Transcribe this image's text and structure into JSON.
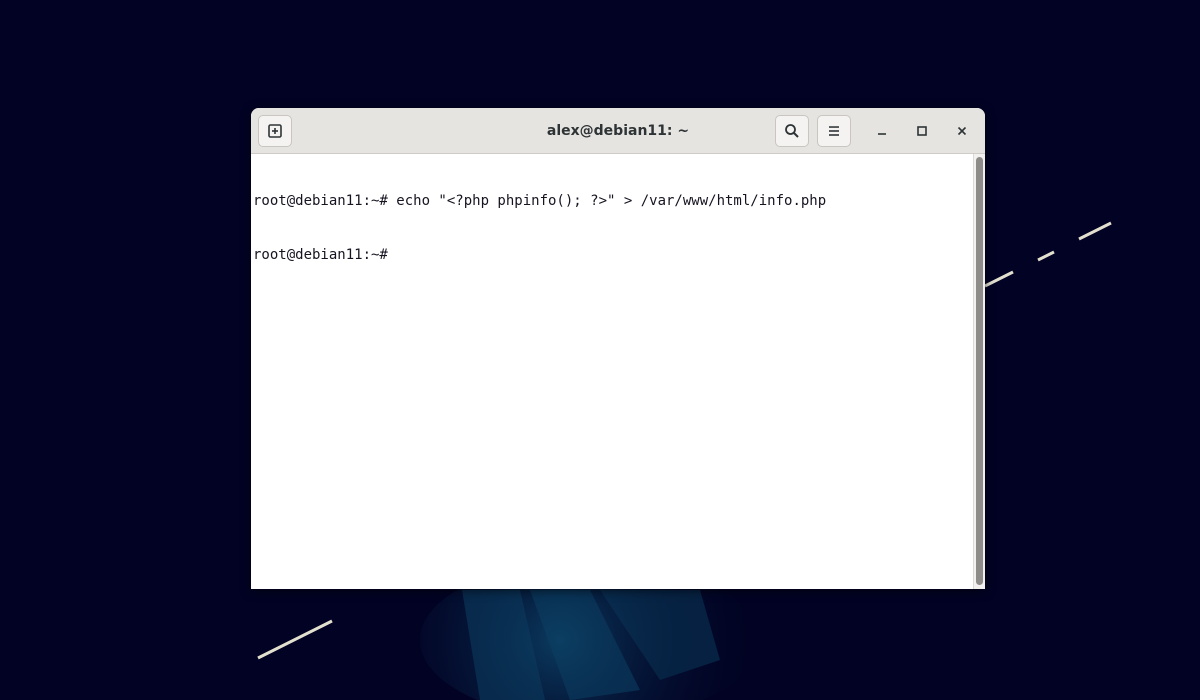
{
  "window": {
    "title": "alex@debian11: ~"
  },
  "icons": {
    "new_tab": "new-tab-icon",
    "search": "search-icon",
    "menu": "hamburger-menu-icon",
    "minimize": "minimize-icon",
    "maximize": "maximize-icon",
    "close": "close-icon"
  },
  "terminal": {
    "lines": [
      "root@debian11:~# echo \"<?php phpinfo(); ?>\" > /var/www/html/info.php",
      "root@debian11:~# "
    ]
  },
  "colors": {
    "desktop_bg": "#020324",
    "headerbar_bg": "#e6e4e1",
    "terminal_bg": "#ffffff",
    "terminal_fg": "#171421"
  }
}
